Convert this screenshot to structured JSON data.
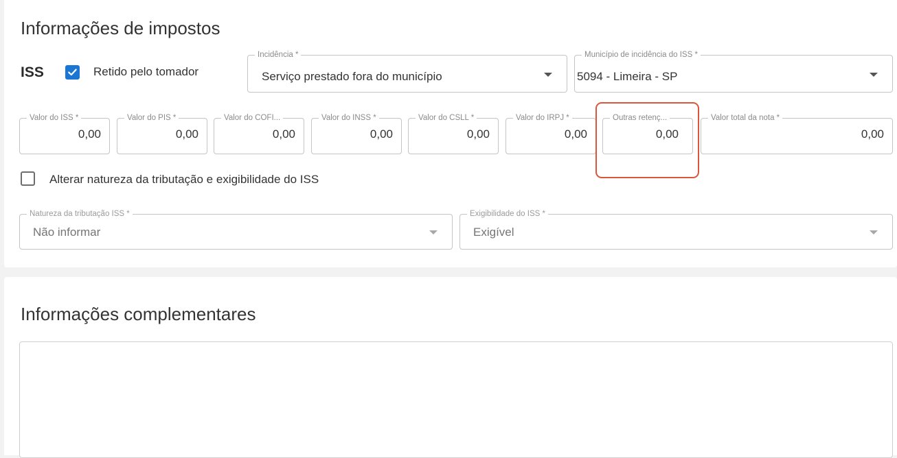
{
  "taxes_section": {
    "title": "Informações de impostos",
    "iss_label": "ISS",
    "retained_checkbox": {
      "label": "Retido pelo tomador",
      "checked": true
    },
    "incidence": {
      "label": "Incidência *",
      "value": "Serviço prestado fora do município"
    },
    "municipality": {
      "label": "Município de incidência do ISS *",
      "value": "5094 - Limeira - SP"
    },
    "tax_fields": [
      {
        "label": "Valor do ISS *",
        "value": "0,00"
      },
      {
        "label": "Valor do PIS *",
        "value": "0,00"
      },
      {
        "label": "Valor do COFI...",
        "value": "0,00"
      },
      {
        "label": "Valor do INSS *",
        "value": "0,00"
      },
      {
        "label": "Valor do CSLL *",
        "value": "0,00"
      },
      {
        "label": "Valor do IRPJ *",
        "value": "0,00"
      },
      {
        "label": "Outras retenç...",
        "value": "0,00"
      },
      {
        "label": "Valor total da nota *",
        "value": "0,00"
      }
    ],
    "alter_checkbox": {
      "label": "Alterar natureza da tributação e exigibilidade do ISS",
      "checked": false
    },
    "nature": {
      "label": "Natureza da tributação ISS *",
      "value": "Não informar"
    },
    "exigibility": {
      "label": "Exigibilidade do ISS *",
      "value": "Exigível"
    }
  },
  "complement_section": {
    "title": "Informações complementares",
    "text_value": ""
  },
  "colors": {
    "accent": "#1976d2",
    "highlight": "#d9563a",
    "border": "#c4c4c4",
    "background": "#f2f2f2"
  }
}
